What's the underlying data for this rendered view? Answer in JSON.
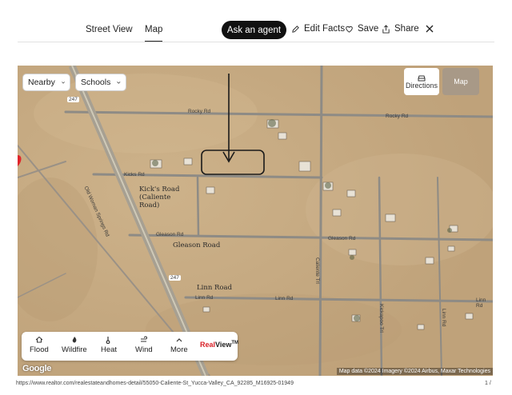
{
  "header": {
    "tabs": [
      {
        "label": "Street View",
        "active": false
      },
      {
        "label": "Map",
        "active": true
      }
    ],
    "agent_button": "Ask an agent",
    "actions": [
      {
        "label": "Edit Facts",
        "icon": "pencil-icon"
      },
      {
        "label": "Save",
        "icon": "heart-icon"
      },
      {
        "label": "Share",
        "icon": "share-icon"
      }
    ],
    "close_icon": "close-icon"
  },
  "map": {
    "filters": [
      {
        "label": "Nearby",
        "icon": "chevron-down-icon"
      },
      {
        "label": "Schools",
        "icon": "chevron-down-icon"
      }
    ],
    "controls": {
      "directions_label": "Directions",
      "map_label": "Map"
    },
    "road_labels": {
      "rocky_left": "Rocky Rd",
      "rocky_right": "Rocky Rd",
      "kicks": "Kicks Rd",
      "gleason_left": "Gleason Rd",
      "gleason_right": "Gleason Rd",
      "linn_left": "Linn Rd",
      "linn_right": "Linn Rd",
      "linn_far": "Linn Rd",
      "old_woman": "Old Woman Springs Rd",
      "route_247_top": "247",
      "route_247_bottom": "247",
      "vertical_1": "Caliente Trl",
      "vertical_2": "Kickapoo Trl",
      "vertical_3": "Linn Rd"
    },
    "annotations": {
      "kicks_road": "Kick's Road",
      "caliente_road": "(Caliente",
      "caliente_road_2": "Road)",
      "gleason_road": "Gleason Road",
      "linn_road": "Linn Road"
    },
    "layers": [
      {
        "label": "Flood",
        "icon": "flood-icon"
      },
      {
        "label": "Wildfire",
        "icon": "wildfire-icon"
      },
      {
        "label": "Heat",
        "icon": "heat-icon"
      },
      {
        "label": "Wind",
        "icon": "wind-icon"
      },
      {
        "label": "More",
        "icon": "chevron-up-icon"
      }
    ],
    "realview": {
      "brand_red": "Real",
      "brand_black": "View",
      "tm": "TM"
    },
    "google_logo": "Google",
    "attribution": "Map data ©2024 Imagery ©2024 Airbus, Maxar Technologies"
  },
  "footer": {
    "url": "https://www.realtor.com/realestateandhomes-detail/55050-Caliente-St_Yucca-Valley_CA_92285_M16925-01949",
    "page": "1 /"
  },
  "colors": {
    "accent_dark": "#111111",
    "realview_red": "#d92228",
    "marker_red": "#e0252b",
    "terrain": "#c7ab82",
    "road": "#8e8b85"
  }
}
